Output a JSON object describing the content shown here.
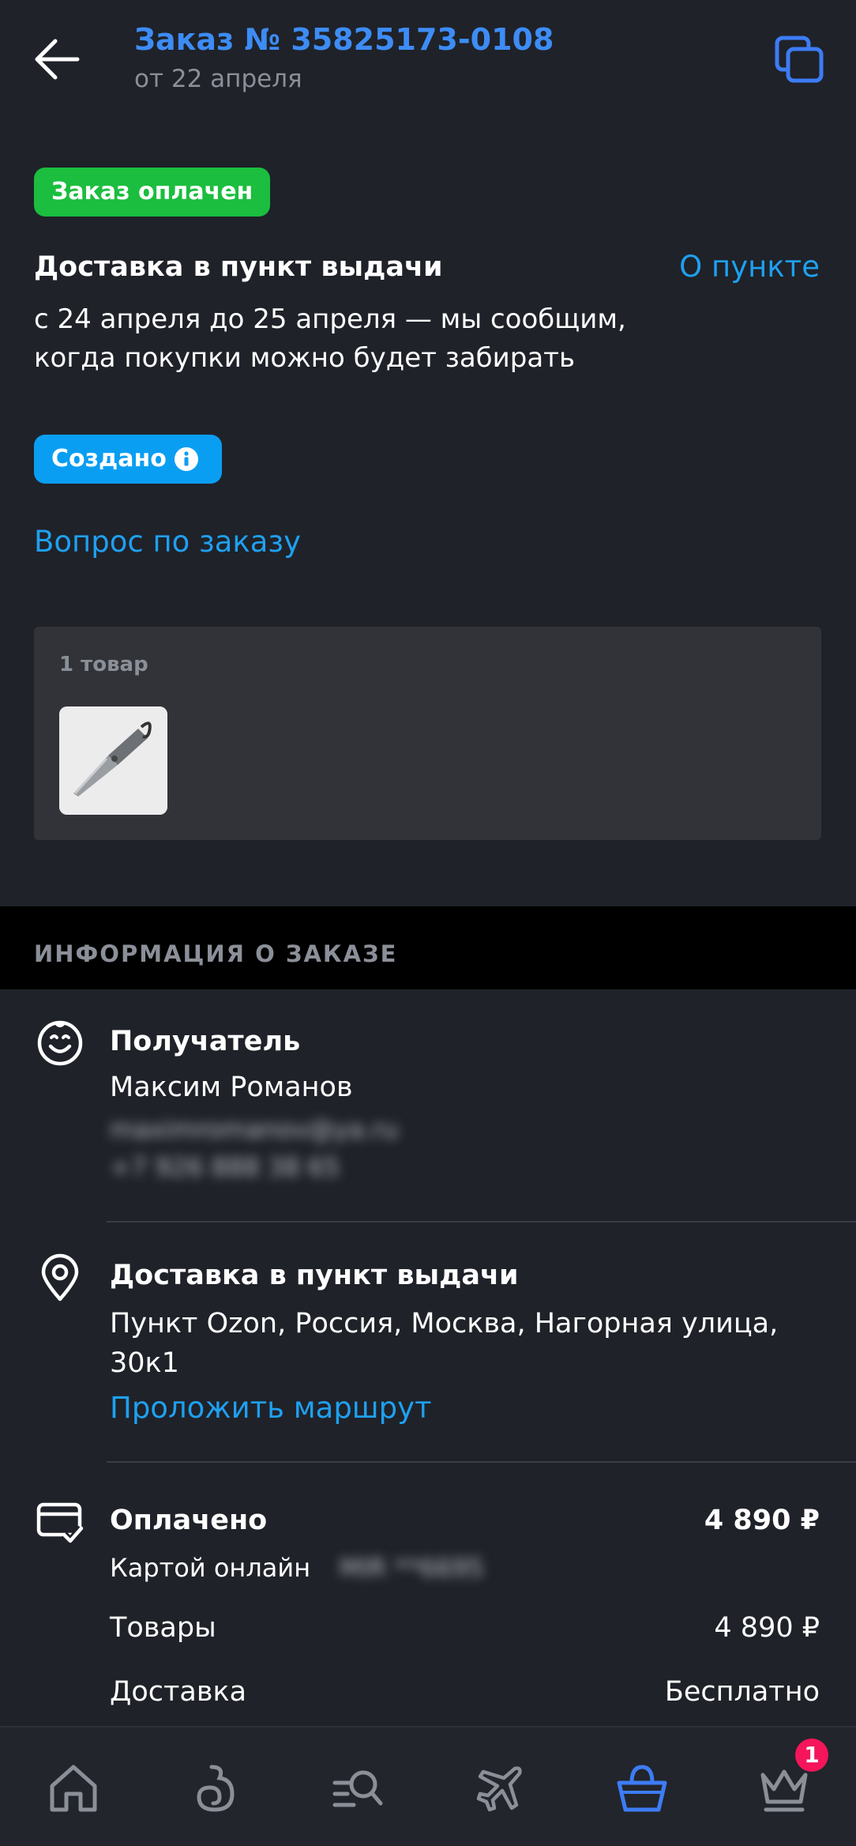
{
  "header": {
    "title": "Заказ № 35825173-0108",
    "subtitle": "от 22 апреля"
  },
  "status_badge": "Заказ оплачен",
  "delivery": {
    "title": "Доставка в пункт выдачи",
    "about_link": "О пункте",
    "text": "с 24 апреля до 25 апреля — мы сообщим, когда покупки можно будет забирать",
    "state_badge": "Создано"
  },
  "question_link": "Вопрос по заказу",
  "items": {
    "count": "1 товар"
  },
  "info_section": {
    "title": "ИНФОРМАЦИЯ О ЗАКАЗЕ",
    "recipient": {
      "label": "Получатель",
      "name": "Максим Романов",
      "email": "maximromanov@ya.ru",
      "phone": "+7 926 888 38 65"
    },
    "pickup": {
      "label": "Доставка в пункт выдачи",
      "address": "Пункт Ozon, Россия, Москва, Нагорная улица, 30к1",
      "route_link": "Проложить маршрут"
    },
    "payment": {
      "label": "Оплачено",
      "amount": "4 890 ₽",
      "method": "Картой онлайн",
      "card": "MIR **6695"
    },
    "goods": {
      "label": "Товары",
      "value": "4 890 ₽"
    },
    "shipping": {
      "label": "Доставка",
      "value": "Бесплатно"
    }
  },
  "tabbar": {
    "badge": "1",
    "active_color": "#3d7cf5",
    "icons": [
      "home-icon",
      "catalog-icon",
      "search-list-icon",
      "travel-icon",
      "cart-icon",
      "premium-icon"
    ]
  },
  "colors": {
    "accent": "#1fa0f0",
    "title_blue": "#3d8cf5",
    "paid_green": "#1bbe3e",
    "created_blue": "#0a9ef2",
    "notification": "#f5155a"
  }
}
